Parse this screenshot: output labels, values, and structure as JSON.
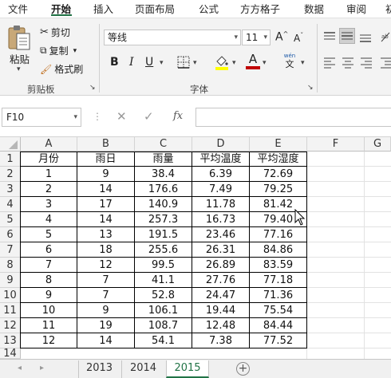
{
  "ribbon_tabs": [
    "文件",
    "开始",
    "插入",
    "页面布局",
    "公式",
    "方方格子",
    "数据",
    "审阅",
    "初"
  ],
  "clipboard": {
    "paste": "粘贴",
    "cut": "剪切",
    "copy": "复制",
    "format_painter": "格式刷",
    "group_label": "剪贴板"
  },
  "font": {
    "name": "等线",
    "size": "11",
    "grow": "A",
    "shrink": "A",
    "bold": "B",
    "italic": "I",
    "underline": "U",
    "font_color_letter": "A",
    "phonetic_top": "wén",
    "phonetic_bottom": "文",
    "group_label": "字体"
  },
  "name_box": "F10",
  "formula_fx": "fx",
  "formula_value": "",
  "columns": [
    "A",
    "B",
    "C",
    "D",
    "E",
    "F",
    "G"
  ],
  "row_numbers": [
    "1",
    "2",
    "3",
    "4",
    "5",
    "6",
    "7",
    "8",
    "9",
    "10",
    "11",
    "12",
    "13",
    "14"
  ],
  "table": {
    "headers": [
      "月份",
      "雨日",
      "雨量",
      "平均温度",
      "平均湿度"
    ],
    "rows": [
      [
        "1",
        "9",
        "38.4",
        "6.39",
        "72.69"
      ],
      [
        "2",
        "14",
        "176.6",
        "7.49",
        "79.25"
      ],
      [
        "3",
        "17",
        "140.9",
        "11.78",
        "81.42"
      ],
      [
        "4",
        "14",
        "257.3",
        "16.73",
        "79.40"
      ],
      [
        "5",
        "13",
        "191.5",
        "23.46",
        "77.16"
      ],
      [
        "6",
        "18",
        "255.6",
        "26.31",
        "84.86"
      ],
      [
        "7",
        "12",
        "99.5",
        "26.89",
        "83.59"
      ],
      [
        "8",
        "7",
        "41.1",
        "27.76",
        "77.18"
      ],
      [
        "9",
        "7",
        "52.8",
        "24.47",
        "71.36"
      ],
      [
        "10",
        "9",
        "106.1",
        "19.44",
        "75.54"
      ],
      [
        "11",
        "19",
        "108.7",
        "12.48",
        "84.44"
      ],
      [
        "12",
        "14",
        "54.1",
        "7.38",
        "77.52"
      ]
    ]
  },
  "sheet_tabs": [
    "2013",
    "2014",
    "2015"
  ],
  "active_sheet": "2015",
  "colors": {
    "accent": "#217346",
    "font_color_bar": "#c00000",
    "highlight_bar": "#ffff00"
  }
}
